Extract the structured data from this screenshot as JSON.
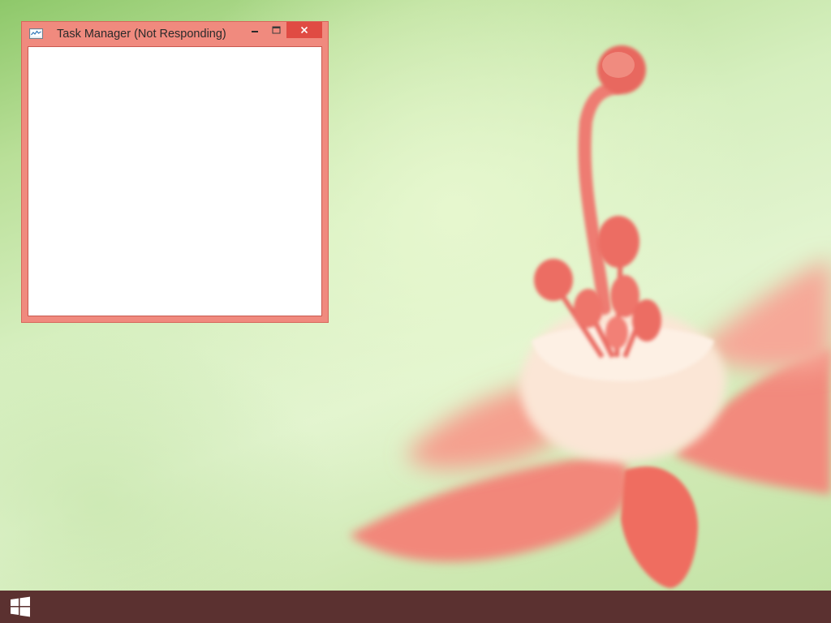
{
  "window": {
    "title": "Task Manager (Not Responding)",
    "icon": "task-manager-icon",
    "controls": {
      "minimize_icon": "minimize-icon",
      "maximize_icon": "maximize-icon",
      "close_icon": "close-icon"
    }
  },
  "taskbar": {
    "start_icon": "windows-logo-icon"
  },
  "colors": {
    "window_frame": "#f08a7e",
    "close_button": "#e04b43",
    "taskbar": "#5b3130",
    "wallpaper_base": "#d6efbf"
  }
}
